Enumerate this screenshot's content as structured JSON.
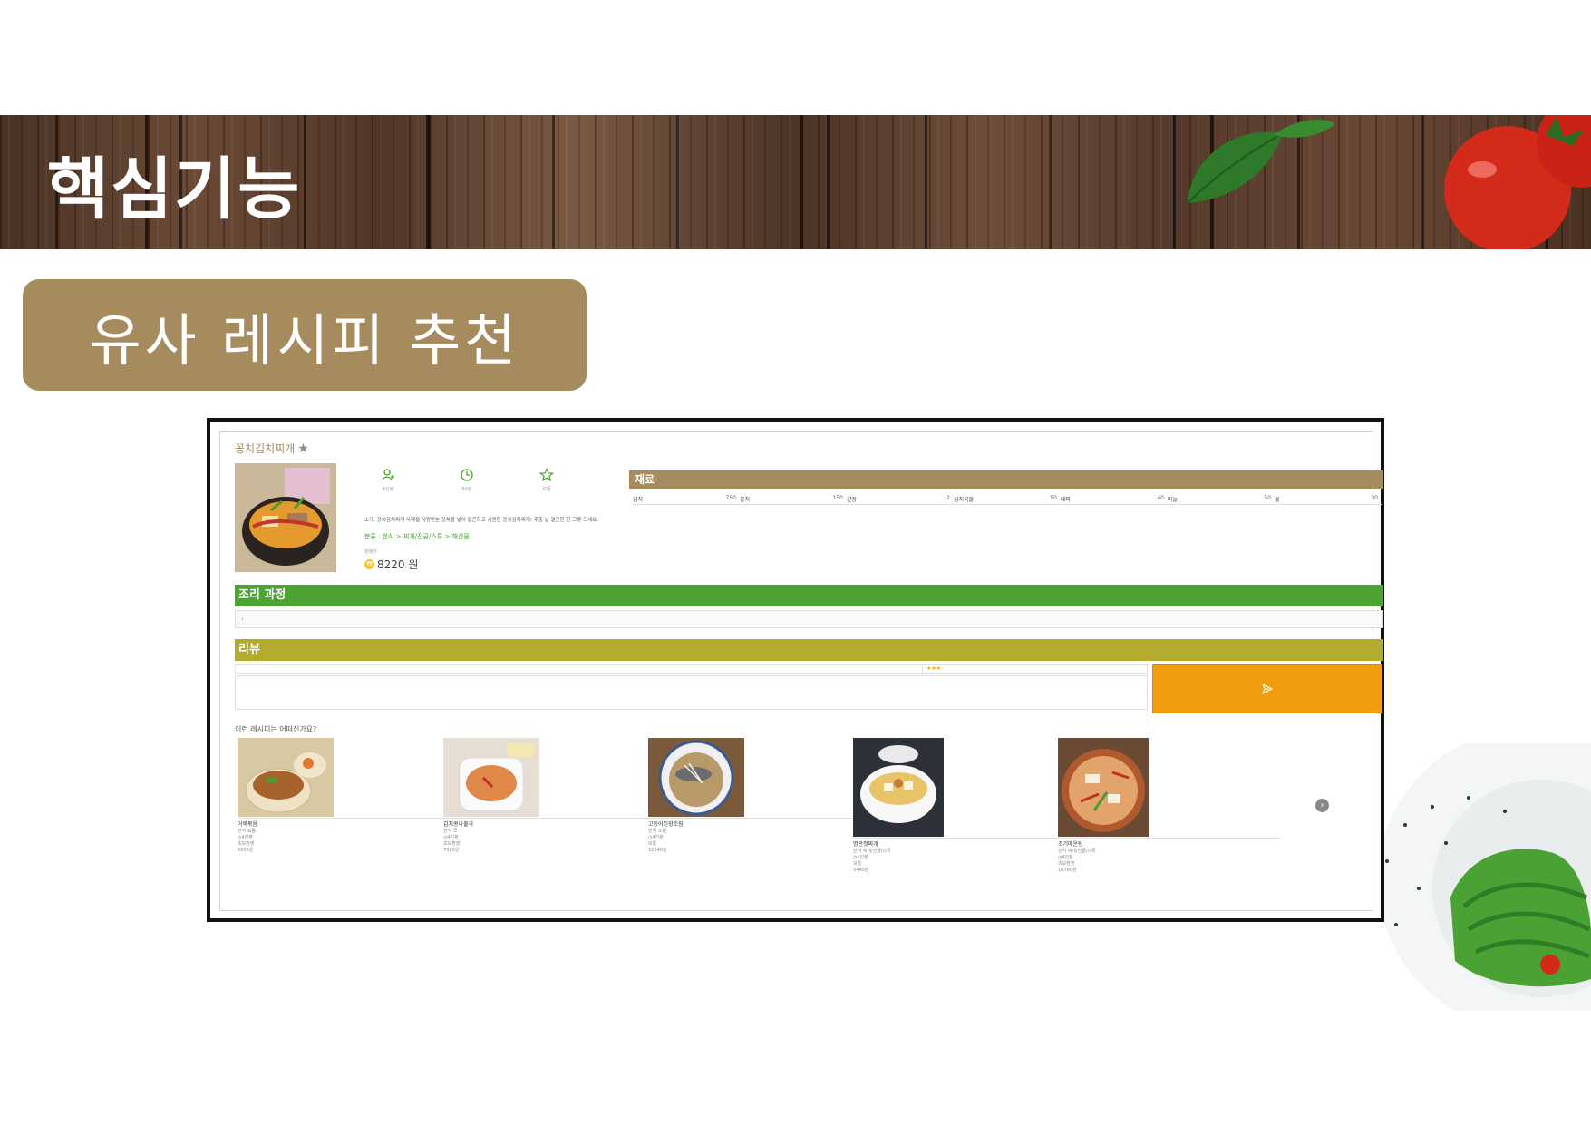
{
  "slide": {
    "title": "핵심기능",
    "subtitle": "유사 레시피 추천"
  },
  "colors": {
    "accent_brown": "#a68b5e",
    "steps_green": "#4ea432",
    "review_olive": "#b3ab2e",
    "submit_orange": "#f09c0c",
    "category_green": "#49a331"
  },
  "recipe": {
    "title": "꽁치김치찌개",
    "favorite_icon": "star-icon",
    "meta": [
      {
        "icon": "person-plus-icon",
        "caption": "4인분"
      },
      {
        "icon": "clock-icon",
        "caption": "60분"
      },
      {
        "icon": "star-outline-icon",
        "caption": "보통"
      }
    ],
    "description": "소개: 꽁치김치찌개 사계절 사랑받는 꽁치를 넣어 얼큰하고 시원한 꽁치김치찌개! 주중 날 얼큰한 한 그릇 드세요.",
    "category": "분류 : 한식 > 찌개/전골/스튜 > 해산물",
    "price_label": "판매가",
    "price": "8220 원",
    "price_icon": "won-coin-icon"
  },
  "ingredients": {
    "header": "재료",
    "items": [
      {
        "name": "김치",
        "qty": "750"
      },
      {
        "name": "꽁치",
        "qty": "150"
      },
      {
        "name": "간장",
        "qty": "2"
      },
      {
        "name": "김치국물",
        "qty": "50"
      },
      {
        "name": "대파",
        "qty": "40"
      },
      {
        "name": "마늘",
        "qty": "50"
      },
      {
        "name": "물",
        "qty": "30"
      }
    ]
  },
  "steps": {
    "header": "조리 과정",
    "first_item": "›"
  },
  "review": {
    "header": "리뷰",
    "rating": "★★★",
    "submit_icon": "send-icon"
  },
  "similar": {
    "question": "이런 레시피는 어떠신가요?",
    "cards": [
      {
        "name": "어묵볶음",
        "info": [
          "한식 볶음",
          "4인분",
          "초보환영",
          "2650원"
        ]
      },
      {
        "name": "김치콩나물국",
        "info": [
          "한식 국",
          "4인분",
          "초보환영",
          "7320원"
        ]
      },
      {
        "name": "고등어된장조림",
        "info": [
          "한식 조림",
          "4인분",
          "보통",
          "12140원"
        ]
      },
      {
        "name": "명란젓찌개",
        "info": [
          "한식 찌개/전골/스튜",
          "4인분",
          "보통",
          "5440원"
        ]
      },
      {
        "name": "조기매운탕",
        "info": [
          "한식 찌개/전골/스튜",
          "4인분",
          "초보환영",
          "10790원"
        ]
      }
    ],
    "next_icon": "chevron-right-icon",
    "next_label": "›"
  }
}
